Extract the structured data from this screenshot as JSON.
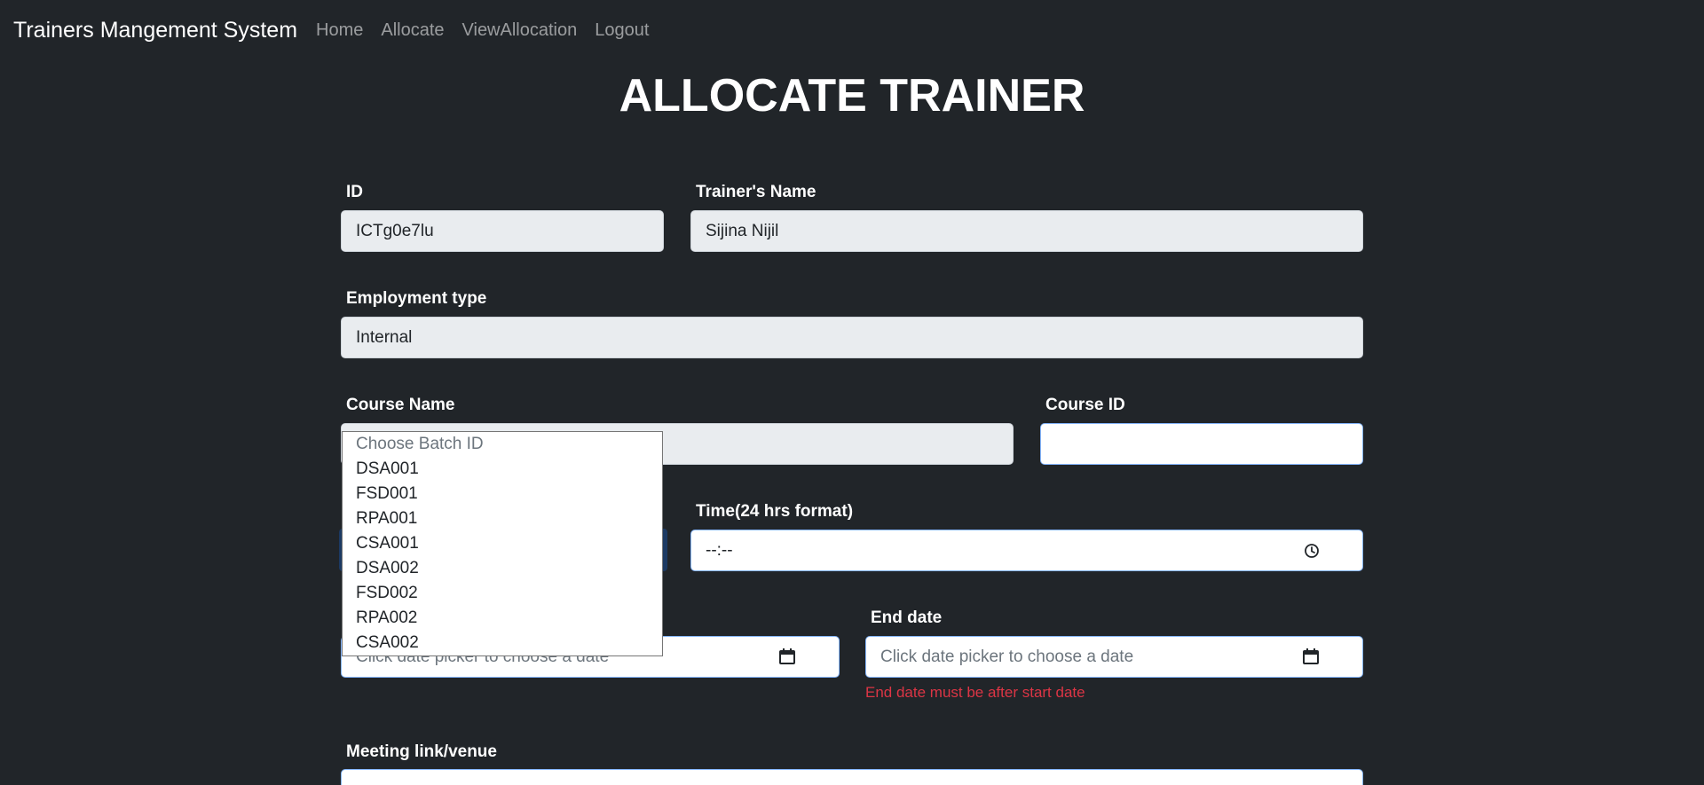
{
  "navbar": {
    "brand": "Trainers Mangement System",
    "links": [
      "Home",
      "Allocate",
      "ViewAllocation",
      "Logout"
    ]
  },
  "page_title": "ALLOCATE TRAINER",
  "form": {
    "id": {
      "label": "ID",
      "value": "ICTg0e7lu"
    },
    "trainer_name": {
      "label": "Trainer's Name",
      "value": "Sijina Nijil"
    },
    "employment_type": {
      "label": "Employment type",
      "value": "Internal"
    },
    "course_name": {
      "label": "Course Name",
      "value": ""
    },
    "course_id": {
      "label": "Course ID",
      "value": ""
    },
    "time": {
      "label": "Time(24 hrs format)",
      "value": "--:--"
    },
    "start_date": {
      "placeholder": "Click date picker to choose a date"
    },
    "end_date": {
      "label": "End date",
      "placeholder": "Click date picker to choose a date",
      "error": "End date must be after start date"
    },
    "meeting": {
      "label": "Meeting link/venue",
      "value": ""
    }
  },
  "batch_dropdown": {
    "placeholder": "Choose Batch ID",
    "options": [
      "DSA001",
      "FSD001",
      "RPA001",
      "CSA001",
      "DSA002",
      "FSD002",
      "RPA002",
      "CSA002"
    ]
  },
  "icons": {
    "calendar": "calendar-icon",
    "clock": "clock-icon"
  },
  "colors": {
    "background": "#212529",
    "error": "#dc3545",
    "focus_border": "#86b7fe"
  }
}
